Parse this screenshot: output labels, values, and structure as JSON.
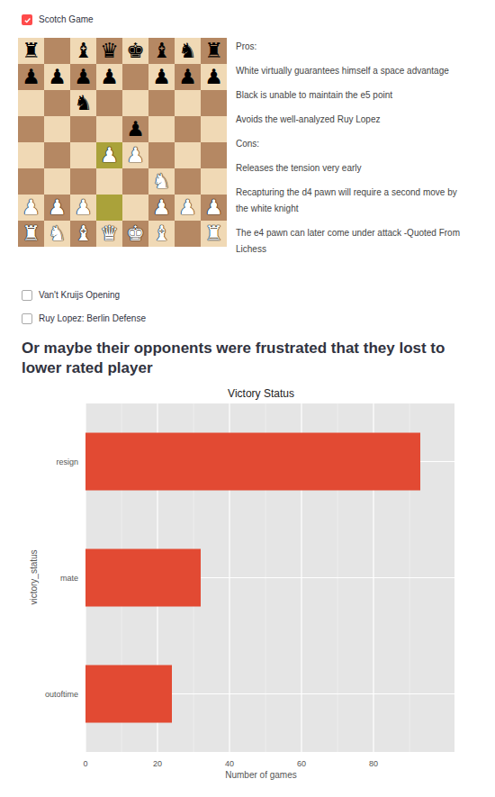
{
  "sections": [
    {
      "label": "Scotch Game",
      "checked": true,
      "board": {
        "ranks": [
          [
            {
              "piece": "♜",
              "side": "black",
              "highlighted": false
            },
            {
              "piece": "",
              "side": "none",
              "highlighted": false
            },
            {
              "piece": "♝",
              "side": "black",
              "highlighted": false
            },
            {
              "piece": "♛",
              "side": "black",
              "highlighted": false
            },
            {
              "piece": "♚",
              "side": "black",
              "highlighted": false
            },
            {
              "piece": "♝",
              "side": "black",
              "highlighted": false
            },
            {
              "piece": "♞",
              "side": "black",
              "highlighted": false
            },
            {
              "piece": "♜",
              "side": "black",
              "highlighted": false
            }
          ],
          [
            {
              "piece": "♟",
              "side": "black",
              "highlighted": false
            },
            {
              "piece": "♟",
              "side": "black",
              "highlighted": false
            },
            {
              "piece": "♟",
              "side": "black",
              "highlighted": false
            },
            {
              "piece": "♟",
              "side": "black",
              "highlighted": false
            },
            {
              "piece": "",
              "side": "none",
              "highlighted": false
            },
            {
              "piece": "♟",
              "side": "black",
              "highlighted": false
            },
            {
              "piece": "♟",
              "side": "black",
              "highlighted": false
            },
            {
              "piece": "♟",
              "side": "black",
              "highlighted": false
            }
          ],
          [
            {
              "piece": "",
              "side": "none",
              "highlighted": false
            },
            {
              "piece": "",
              "side": "none",
              "highlighted": false
            },
            {
              "piece": "♞",
              "side": "black",
              "highlighted": false
            },
            {
              "piece": "",
              "side": "none",
              "highlighted": false
            },
            {
              "piece": "",
              "side": "none",
              "highlighted": false
            },
            {
              "piece": "",
              "side": "none",
              "highlighted": false
            },
            {
              "piece": "",
              "side": "none",
              "highlighted": false
            },
            {
              "piece": "",
              "side": "none",
              "highlighted": false
            }
          ],
          [
            {
              "piece": "",
              "side": "none",
              "highlighted": false
            },
            {
              "piece": "",
              "side": "none",
              "highlighted": false
            },
            {
              "piece": "",
              "side": "none",
              "highlighted": false
            },
            {
              "piece": "",
              "side": "none",
              "highlighted": false
            },
            {
              "piece": "♟",
              "side": "black",
              "highlighted": false
            },
            {
              "piece": "",
              "side": "none",
              "highlighted": false
            },
            {
              "piece": "",
              "side": "none",
              "highlighted": false
            },
            {
              "piece": "",
              "side": "none",
              "highlighted": false
            }
          ],
          [
            {
              "piece": "",
              "side": "none",
              "highlighted": false
            },
            {
              "piece": "",
              "side": "none",
              "highlighted": false
            },
            {
              "piece": "",
              "side": "none",
              "highlighted": false
            },
            {
              "piece": "♟",
              "side": "white",
              "highlighted": true
            },
            {
              "piece": "♟",
              "side": "white",
              "highlighted": false
            },
            {
              "piece": "",
              "side": "none",
              "highlighted": false
            },
            {
              "piece": "",
              "side": "none",
              "highlighted": false
            },
            {
              "piece": "",
              "side": "none",
              "highlighted": false
            }
          ],
          [
            {
              "piece": "",
              "side": "none",
              "highlighted": false
            },
            {
              "piece": "",
              "side": "none",
              "highlighted": false
            },
            {
              "piece": "",
              "side": "none",
              "highlighted": false
            },
            {
              "piece": "",
              "side": "none",
              "highlighted": false
            },
            {
              "piece": "",
              "side": "none",
              "highlighted": false
            },
            {
              "piece": "♞",
              "side": "white",
              "highlighted": false
            },
            {
              "piece": "",
              "side": "none",
              "highlighted": false
            },
            {
              "piece": "",
              "side": "none",
              "highlighted": false
            }
          ],
          [
            {
              "piece": "♟",
              "side": "white",
              "highlighted": false
            },
            {
              "piece": "♟",
              "side": "white",
              "highlighted": false
            },
            {
              "piece": "♟",
              "side": "white",
              "highlighted": false
            },
            {
              "piece": "",
              "side": "none",
              "highlighted": true
            },
            {
              "piece": "",
              "side": "none",
              "highlighted": false
            },
            {
              "piece": "♟",
              "side": "white",
              "highlighted": false
            },
            {
              "piece": "♟",
              "side": "white",
              "highlighted": false
            },
            {
              "piece": "♟",
              "side": "white",
              "highlighted": false
            }
          ],
          [
            {
              "piece": "♜",
              "side": "white",
              "highlighted": false
            },
            {
              "piece": "♞",
              "side": "white",
              "highlighted": false
            },
            {
              "piece": "♝",
              "side": "white",
              "highlighted": false
            },
            {
              "piece": "♛",
              "side": "white",
              "highlighted": false
            },
            {
              "piece": "♚",
              "side": "white",
              "highlighted": false
            },
            {
              "piece": "♝",
              "side": "white",
              "highlighted": false
            },
            {
              "piece": "",
              "side": "none",
              "highlighted": false
            },
            {
              "piece": "♜",
              "side": "white",
              "highlighted": false
            }
          ]
        ]
      },
      "notes": [
        "Pros:",
        "White virtually guarantees himself a space advantage",
        "Black is unable to maintain the e5 point",
        "Avoids the well-analyzed Ruy Lopez",
        "Cons:",
        "Releases the tension very early",
        "Recapturing the d4 pawn will require a second move by the white knight",
        "The e4 pawn can later come under attack -Quoted From Lichess"
      ]
    },
    {
      "label": "Van't Kruijs Opening",
      "checked": false
    },
    {
      "label": "Ruy Lopez: Berlin Defense",
      "checked": false
    }
  ],
  "heading": "Or maybe their opponents were frustrated that they lost to lower rated player",
  "chart": {
    "title": "Victory Status",
    "x_axis": {
      "label": "Number of games",
      "ticks": [
        {
          "label": "0",
          "value": 0
        },
        {
          "label": "20",
          "value": 20
        },
        {
          "label": "40",
          "value": 40
        },
        {
          "label": "60",
          "value": 60
        },
        {
          "label": "80",
          "value": 80
        }
      ]
    },
    "y_axis": {
      "label": "victory_status"
    },
    "categories": [
      "resign",
      "mate",
      "outoftime"
    ],
    "values": [
      93,
      32,
      24
    ]
  }
}
